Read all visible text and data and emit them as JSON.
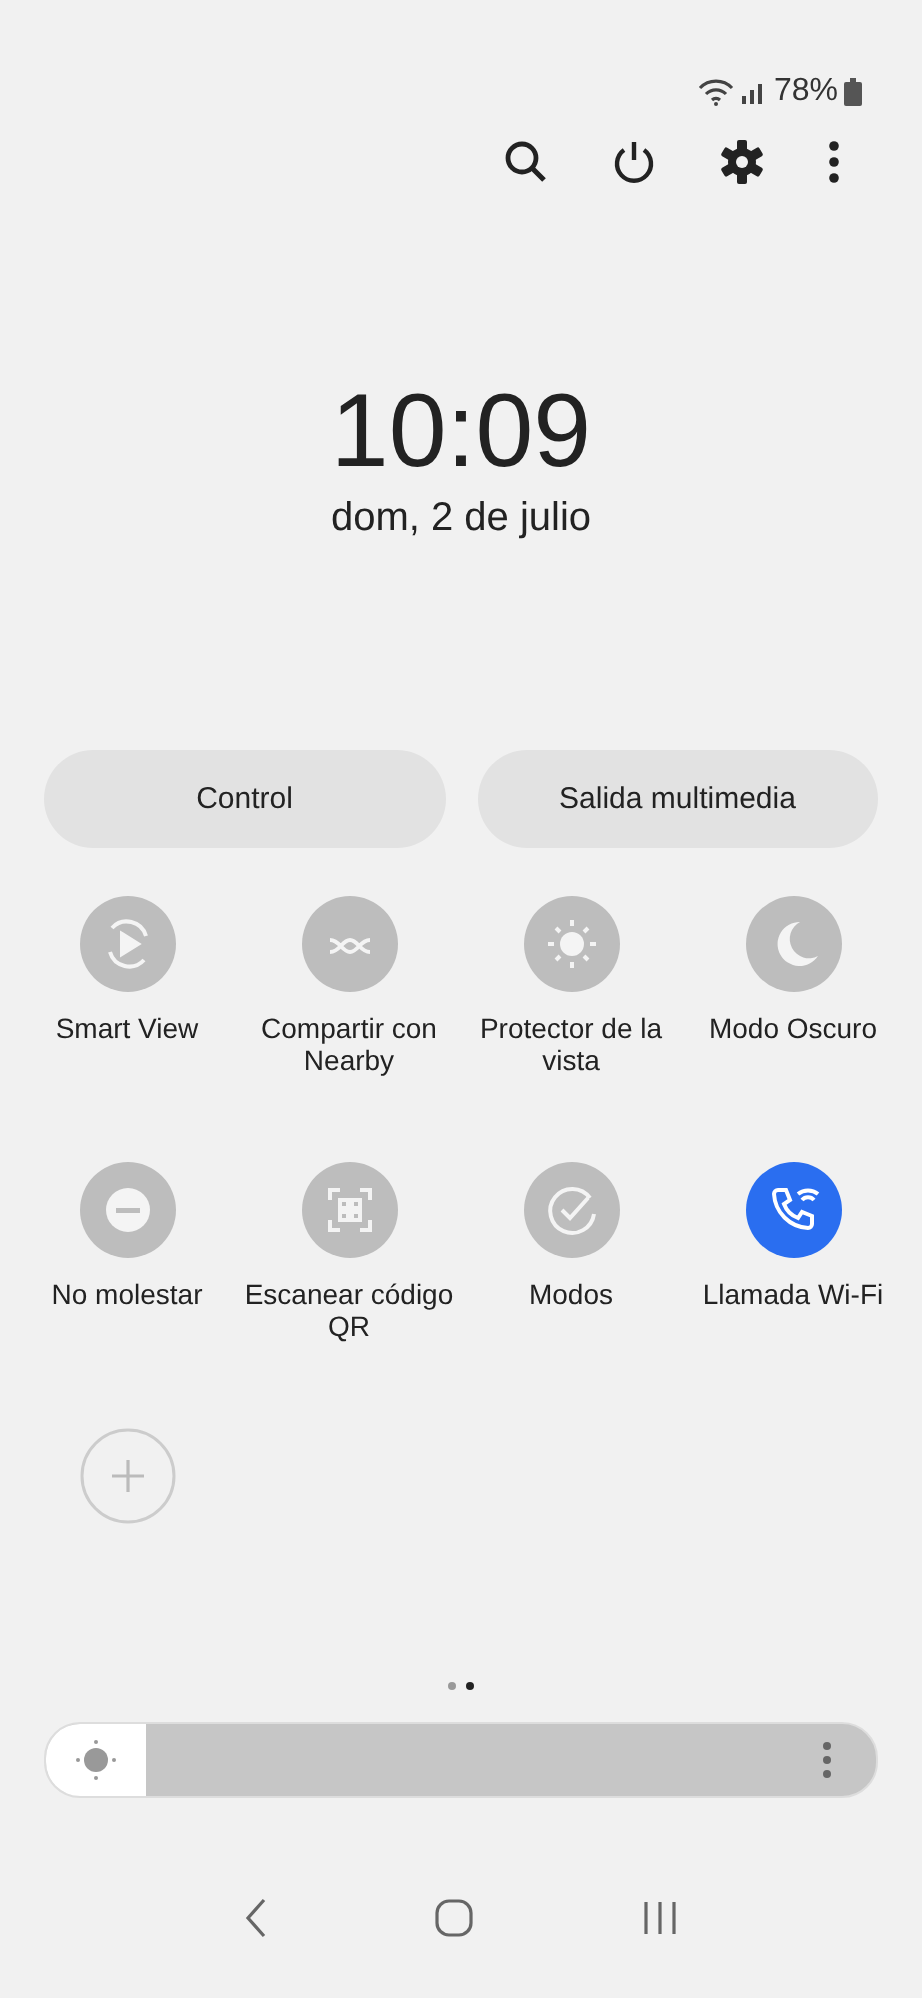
{
  "status_bar": {
    "battery": "78%"
  },
  "toolbar": {
    "actions": [
      {
        "kind": "search"
      },
      {
        "kind": "power"
      },
      {
        "kind": "settings"
      },
      {
        "kind": "more"
      }
    ]
  },
  "clock": {
    "time": "10:09",
    "date": "dom, 2 de julio"
  },
  "panel_buttons": [
    "Control",
    "Salida multimedia"
  ],
  "tiles": [
    {
      "kind": "smart_view",
      "label": "Smart View",
      "on": false
    },
    {
      "kind": "nearby",
      "label": "Compartir con Nearby",
      "on": false
    },
    {
      "kind": "eye",
      "label": "Protector de la vista",
      "on": false
    },
    {
      "kind": "dark",
      "label": "Modo Oscuro",
      "on": false
    },
    {
      "kind": "dnd",
      "label": "No molestar",
      "on": false
    },
    {
      "kind": "qr",
      "label": "Escanear código QR",
      "on": false
    },
    {
      "kind": "modes",
      "label": "Modos",
      "on": false
    },
    {
      "kind": "wifi_call",
      "label": "Llamada Wi-Fi",
      "on": true
    }
  ],
  "page_dots": [
    {
      "selected": false
    },
    {
      "selected": true
    }
  ],
  "brightness": {
    "level": 0.12
  }
}
